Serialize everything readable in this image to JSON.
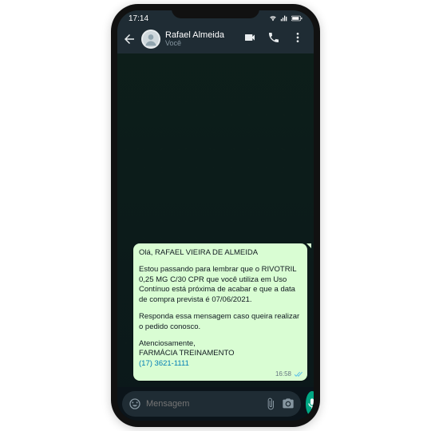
{
  "status": {
    "time": "17:14"
  },
  "header": {
    "contact_name": "Rafael Almeida",
    "contact_sub": "Você"
  },
  "message": {
    "greeting": "Olá, RAFAEL VIEIRA DE ALMEIDA",
    "body": "Estou passando para lembrar que o RIVOTRIL 0,25 MG C/30 CPR que você utiliza em Uso Contínuo está próxima de acabar e que a data de compra prevista é 07/06/2021.",
    "reply_prompt": "Responda essa mensagem caso queira realizar o pedido conosco.",
    "signoff": "Atenciosamente,",
    "sender": "FARMÁCIA TREINAMENTO",
    "phone": "(17) 3621-1111",
    "time": "16:58"
  },
  "input": {
    "placeholder": "Mensagem"
  }
}
